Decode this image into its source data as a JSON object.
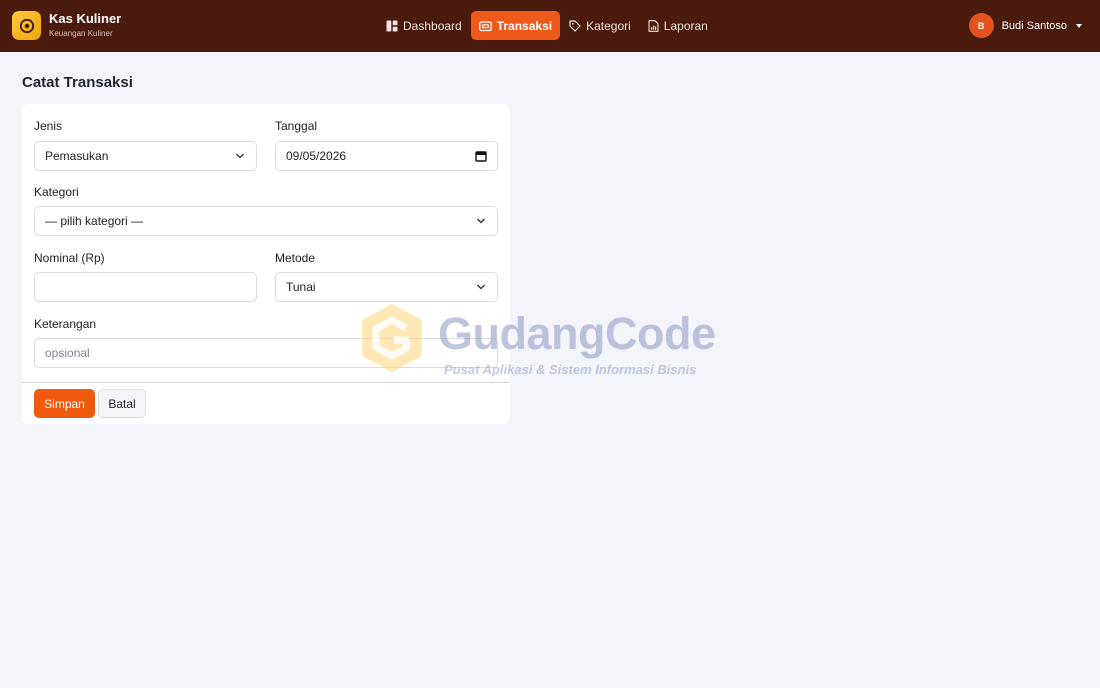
{
  "brand": {
    "title": "Kas Kuliner",
    "subtitle": "Keuangan Kuliner"
  },
  "nav": {
    "items": [
      {
        "label": "Dashboard",
        "icon": "dashboard-icon",
        "active": false
      },
      {
        "label": "Transaksi",
        "icon": "wallet-icon",
        "active": true
      },
      {
        "label": "Kategori",
        "icon": "tag-icon",
        "active": false
      },
      {
        "label": "Laporan",
        "icon": "report-icon",
        "active": false
      }
    ]
  },
  "user": {
    "initial": "B",
    "name": "Budi Santoso"
  },
  "page": {
    "title": "Catat Transaksi"
  },
  "form": {
    "jenis": {
      "label": "Jenis",
      "value": "Pemasukan"
    },
    "tanggal": {
      "label": "Tanggal",
      "value": "09/05/2026"
    },
    "kategori": {
      "label": "Kategori",
      "value": "— pilih kategori —"
    },
    "nominal": {
      "label": "Nominal (Rp)",
      "value": ""
    },
    "metode": {
      "label": "Metode",
      "value": "Tunai"
    },
    "keterangan": {
      "label": "Keterangan",
      "value": "",
      "placeholder": "opsional"
    },
    "save_label": "Simpan",
    "cancel_label": "Batal"
  },
  "watermark": {
    "title": "GudangCode",
    "subtitle": "Pusat Aplikasi & Sistem Informasi Bisnis"
  },
  "colors": {
    "navbar": "#4a1a0c",
    "accent": "#ef5a0e",
    "background": "#f4f5fa"
  }
}
